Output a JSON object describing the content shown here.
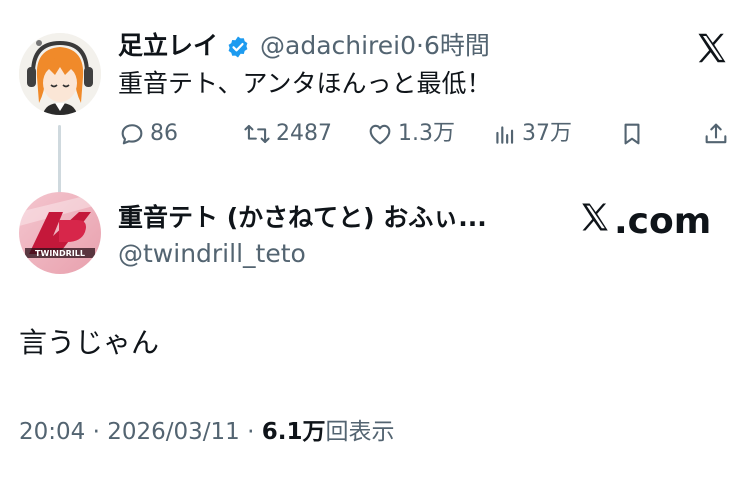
{
  "tweet": {
    "author_name": "足立レイ",
    "author_handle": "@adachirei0",
    "separator": "·",
    "time_ago": "6時間",
    "text": "重音テト、アンタほんっと最低！",
    "stats": {
      "replies": "86",
      "retweets": "2487",
      "likes": "1.3万",
      "views": "37万"
    }
  },
  "quoted": {
    "author_name": "重音テト (かさねてと) おふぃ...",
    "author_handle": "@twindrill_teto",
    "site_label": ".com",
    "text": "言うじゃん",
    "meta": {
      "time": "20:04",
      "separator": "·",
      "date": "2026/03/11",
      "views_count": "6.1万",
      "views_label": "回表示"
    }
  },
  "icons": {
    "verified": "verified-badge-icon",
    "brand": "x-logo-icon",
    "reply": "reply-icon",
    "retweet": "retweet-icon",
    "like": "heart-icon",
    "views": "bar-chart-icon",
    "bookmark": "bookmark-icon",
    "share": "share-icon"
  },
  "colors": {
    "verified_blue": "#1d9bf0",
    "secondary_text": "#536471",
    "primary_text": "#0f1419"
  }
}
